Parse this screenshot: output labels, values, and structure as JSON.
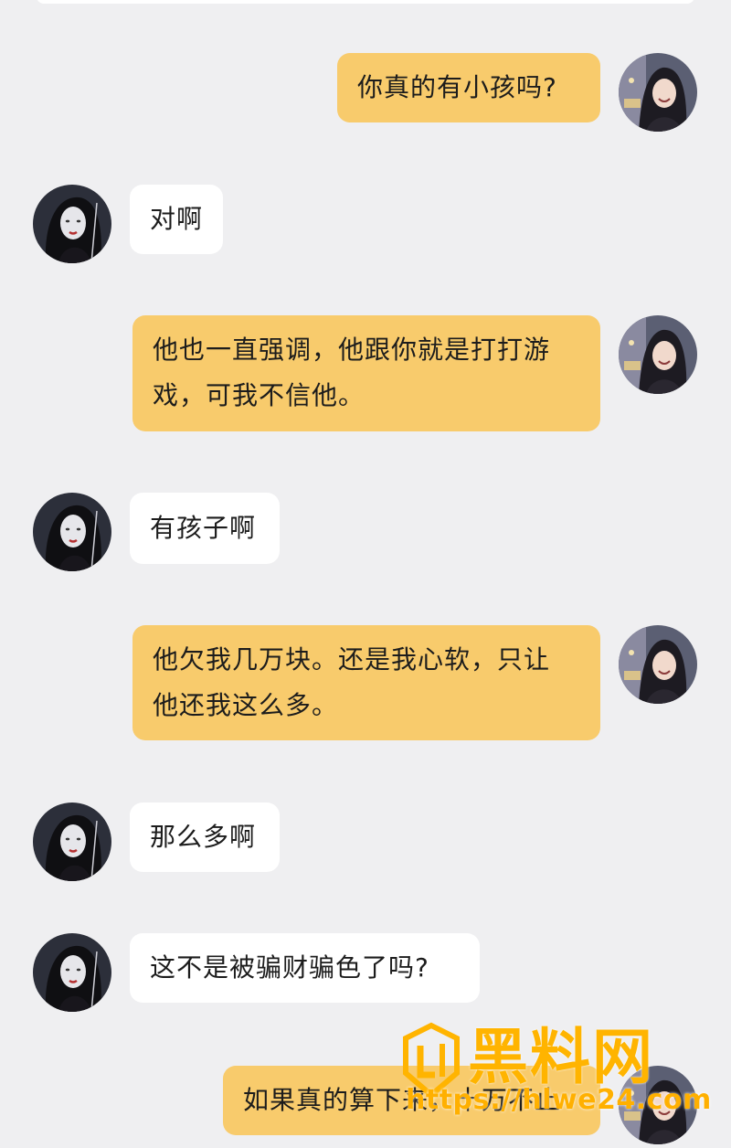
{
  "messages": [
    {
      "side": "me",
      "lines": [
        "你真的有小孩吗?"
      ]
    },
    {
      "side": "them",
      "lines": [
        "对啊"
      ]
    },
    {
      "side": "me",
      "lines": [
        "他也一直强调，他跟你就是打打游",
        "戏，可我不信他。"
      ]
    },
    {
      "side": "them",
      "lines": [
        "有孩子啊"
      ]
    },
    {
      "side": "me",
      "lines": [
        "他欠我几万块。还是我心软，只让",
        "他还我这么多。"
      ]
    },
    {
      "side": "them",
      "lines": [
        "那么多啊"
      ]
    },
    {
      "side": "them",
      "lines": [
        "这不是被骗财骗色了吗?"
      ]
    },
    {
      "side": "me",
      "lines": [
        "如果真的算下来，十万不止"
      ]
    }
  ],
  "colors": {
    "me_bubble": "#f8cb6c",
    "them_bubble": "#ffffff",
    "background": "#efeff1",
    "watermark": "#ffb400"
  },
  "watermark": {
    "title": "黑料网",
    "url": "https://hlwe24.com"
  }
}
